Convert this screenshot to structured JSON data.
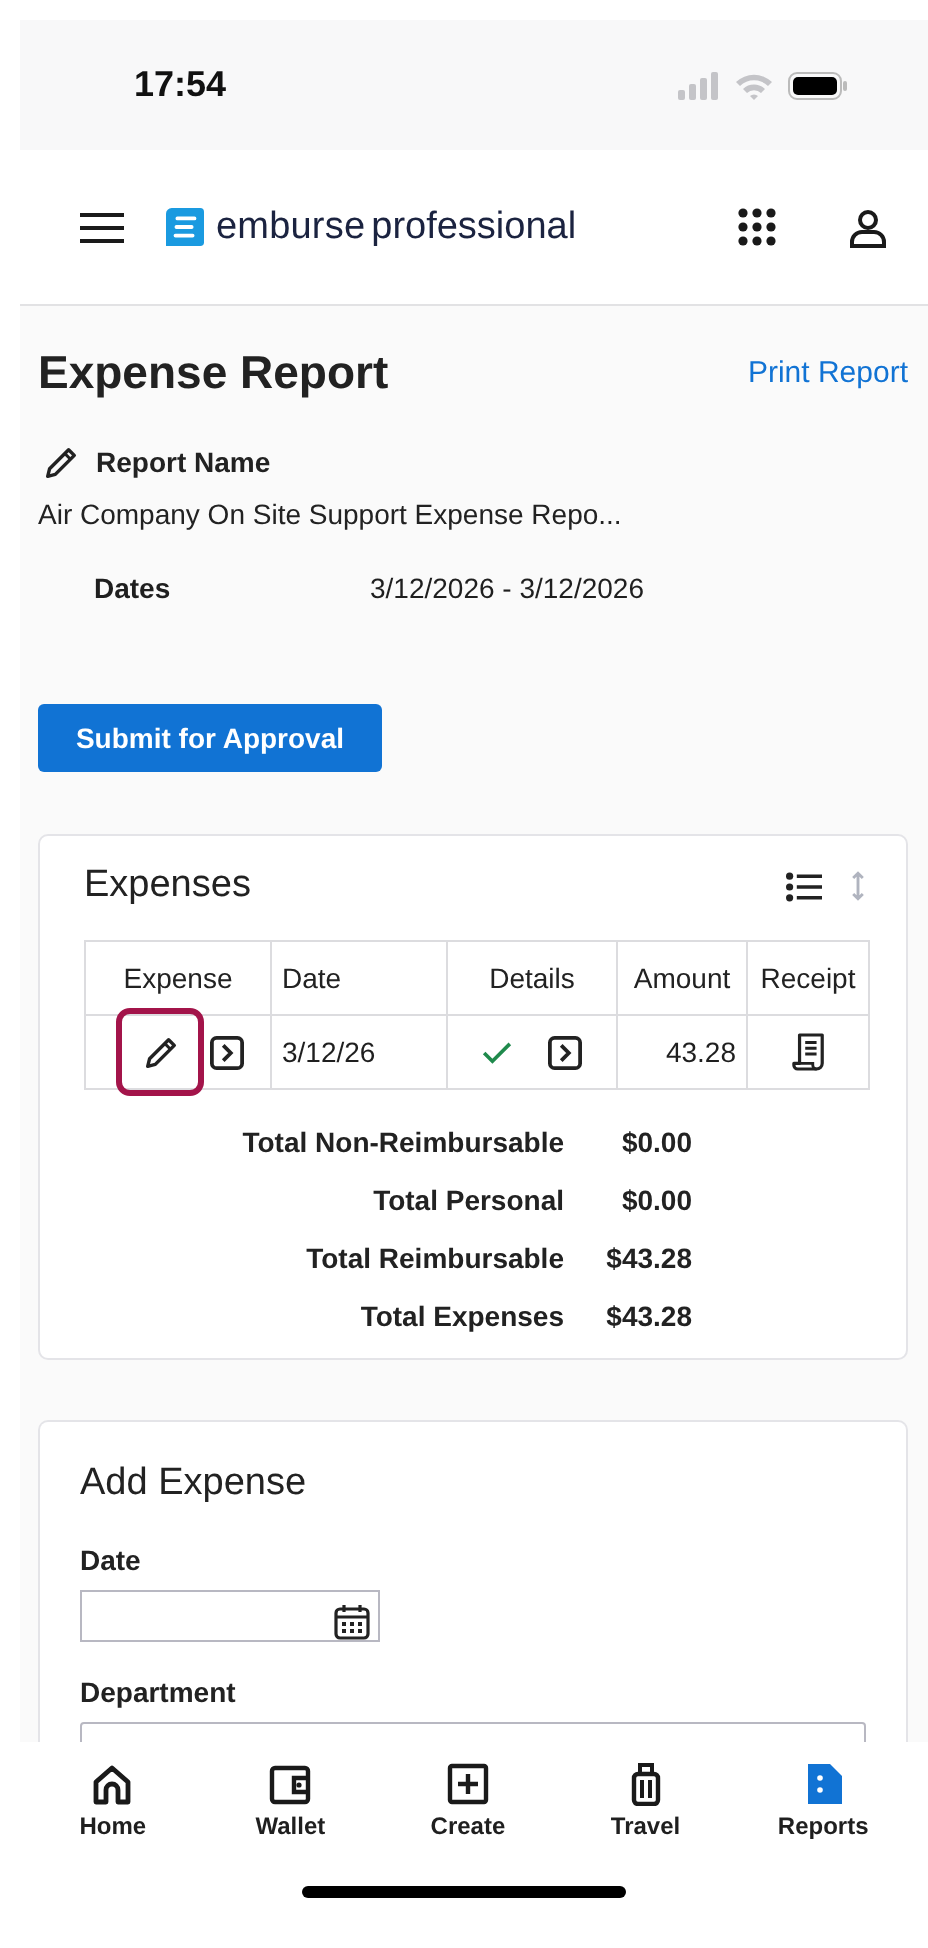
{
  "status_bar": {
    "time": "17:54"
  },
  "header": {
    "brand_bold": "emburse",
    "brand_light": "professional"
  },
  "report": {
    "title": "Expense Report",
    "print_link": "Print Report",
    "name_label": "Report Name",
    "name": "Air Company On Site Support Expense Repo...",
    "dates_label": "Dates",
    "dates": "3/12/2026 - 3/12/2026",
    "submit_button": "Submit for Approval"
  },
  "expenses": {
    "title": "Expenses",
    "columns": [
      "Expense",
      "Date",
      "Details",
      "Amount",
      "Receipt"
    ],
    "rows": [
      {
        "edit_focused": true,
        "date": "3/12/26",
        "details_complete": true,
        "amount": "43.28"
      }
    ],
    "totals": [
      {
        "label": "Total Non-Reimbursable",
        "value": "$0.00"
      },
      {
        "label": "Total Personal",
        "value": "$0.00"
      },
      {
        "label": "Total Reimbursable",
        "value": "$43.28"
      },
      {
        "label": "Total Expenses",
        "value": "$43.28"
      }
    ]
  },
  "add_expense": {
    "title": "Add Expense",
    "fields": [
      {
        "kind": "date",
        "label": "Date"
      },
      {
        "kind": "select",
        "label": "Department"
      }
    ]
  },
  "tab_bar": [
    {
      "kind": "home",
      "label": "Home",
      "selected": false
    },
    {
      "kind": "wallet",
      "label": "Wallet",
      "selected": false
    },
    {
      "kind": "create",
      "label": "Create",
      "selected": false
    },
    {
      "kind": "travel",
      "label": "Travel",
      "selected": false
    },
    {
      "kind": "reports",
      "label": "Reports",
      "selected": true
    }
  ]
}
